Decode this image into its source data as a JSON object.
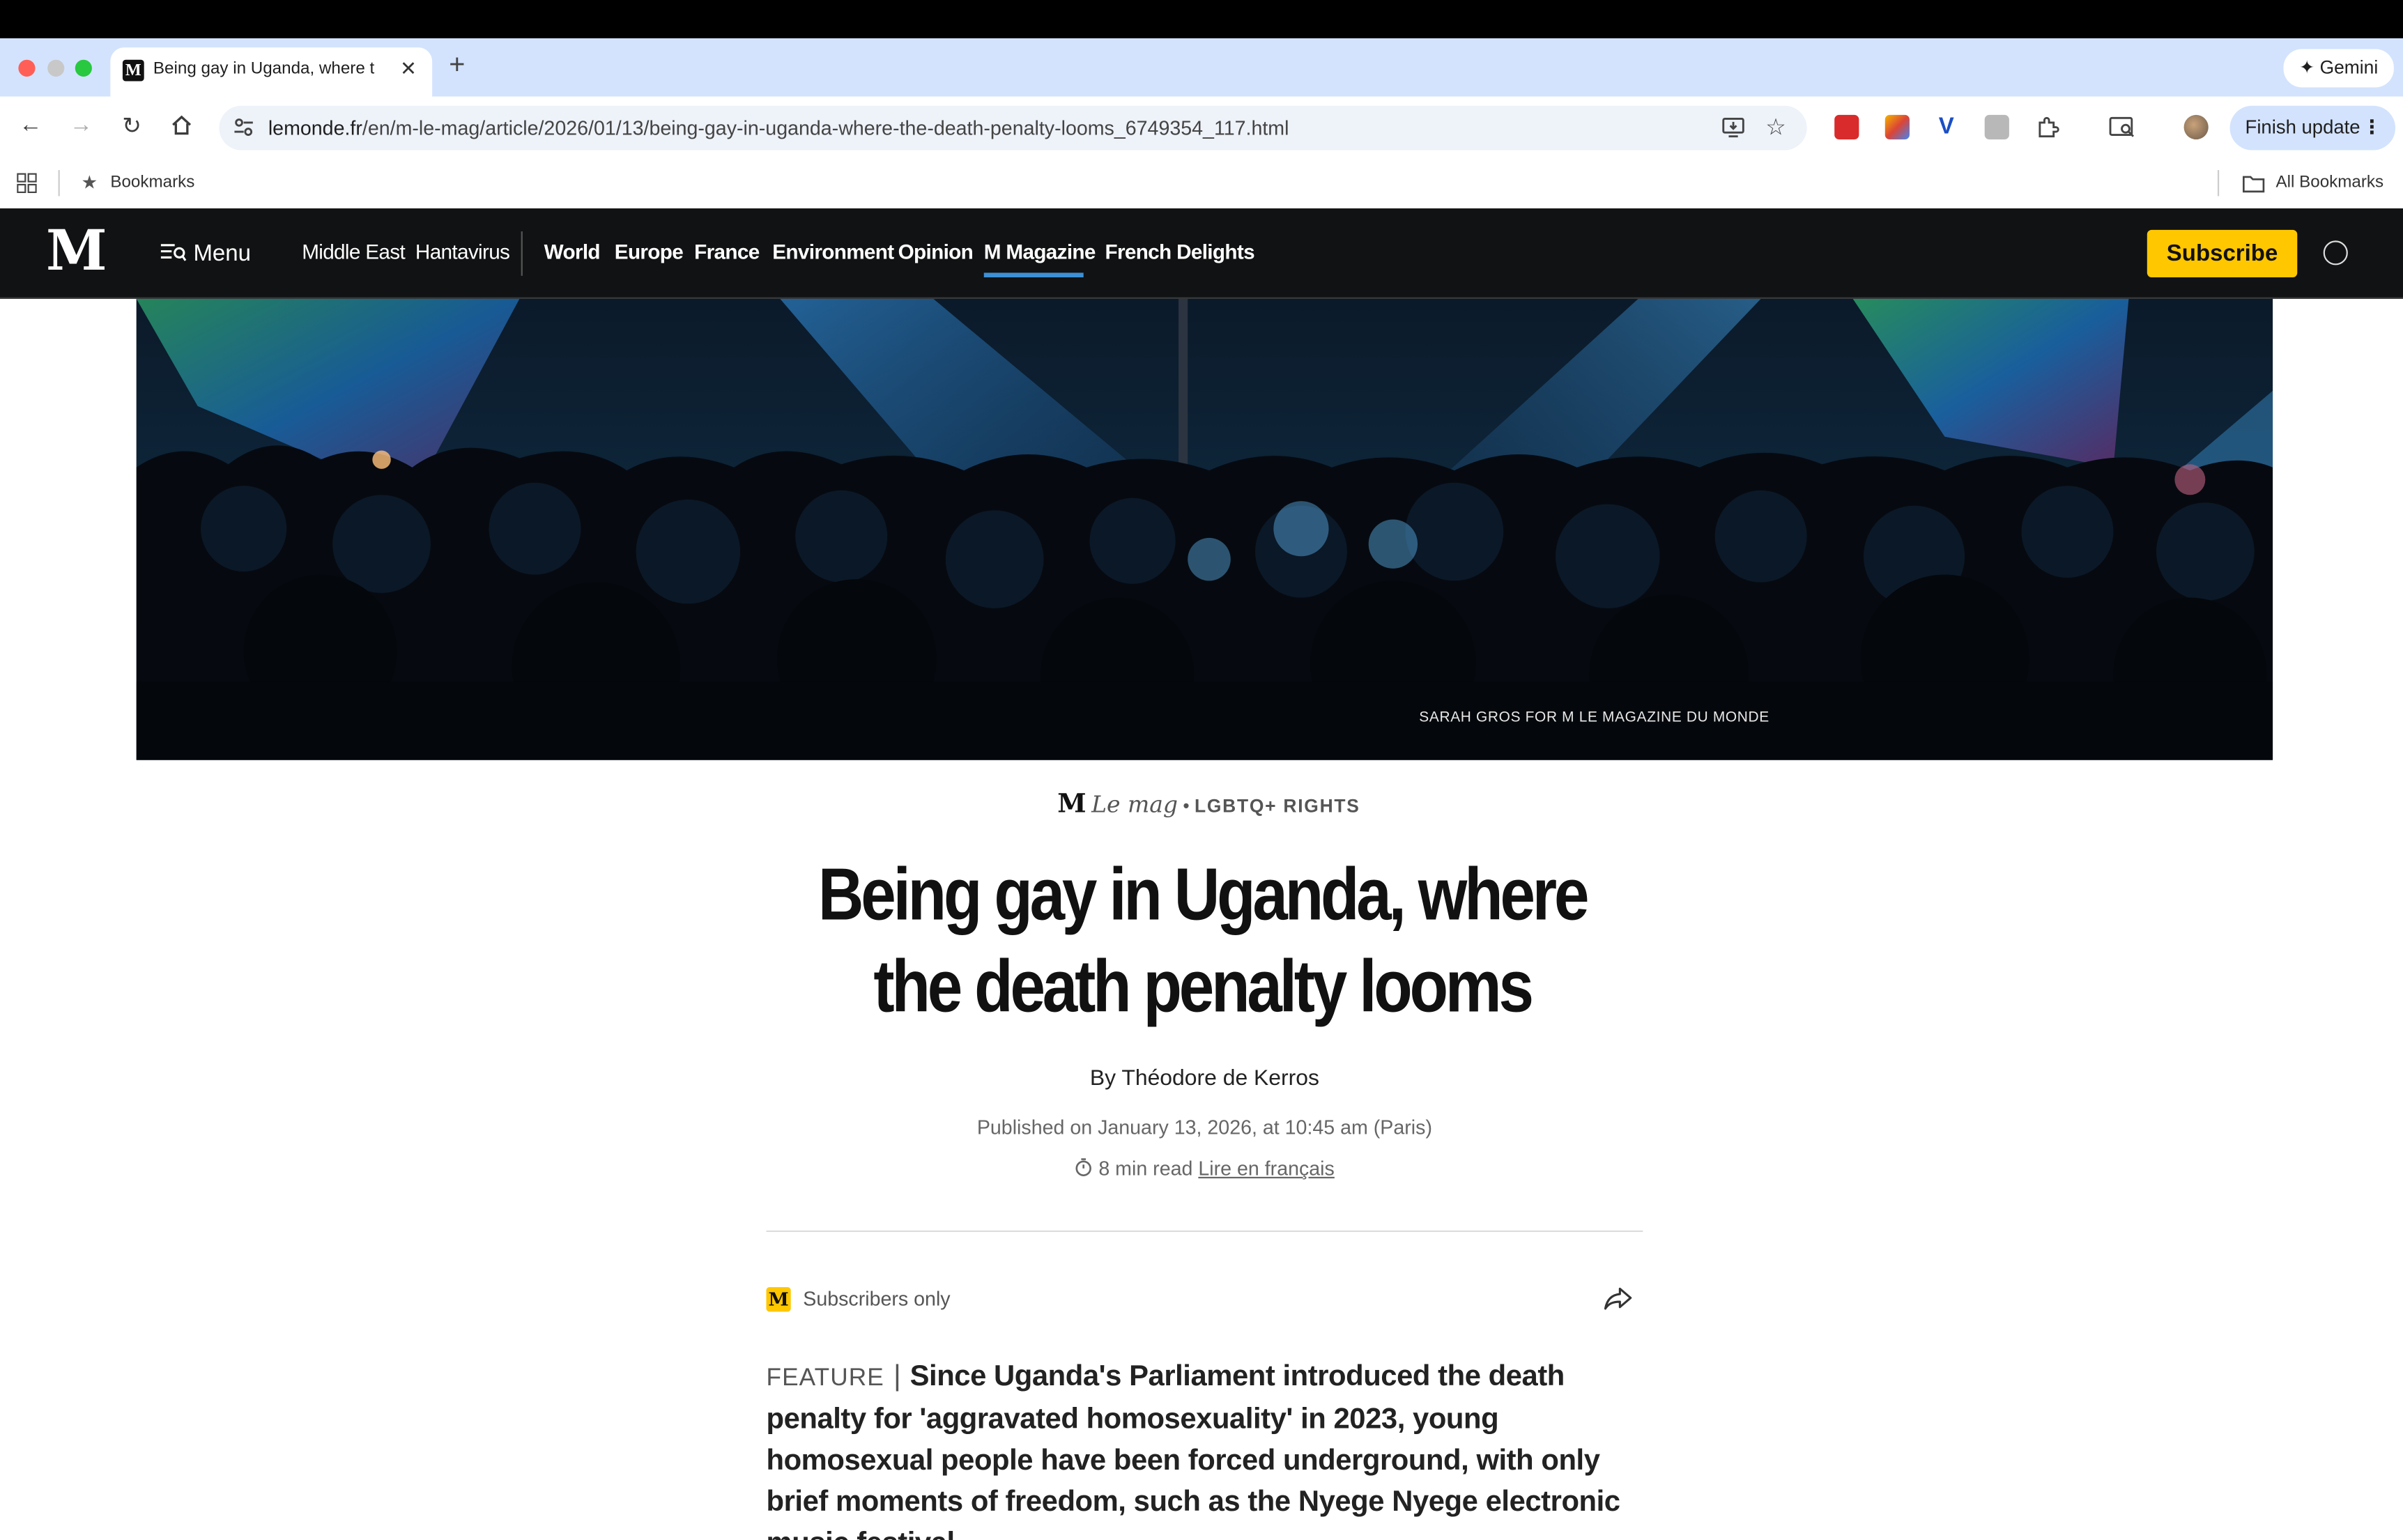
{
  "browser": {
    "tab_title": "Being gay in Uganda, where t",
    "tab_favicon": "M",
    "new_tab_label": "+",
    "gemini_label": "Gemini",
    "url_host": "lemonde.fr",
    "url_path": "/en/m-le-mag/article/2026/01/13/being-gay-in-uganda-where-the-death-penalty-looms_6749354_117.html",
    "finish_update_label": "Finish update",
    "bookmarks_label": "Bookmarks",
    "all_bookmarks_label": "All Bookmarks"
  },
  "site_nav": {
    "logo": "M",
    "menu_label": "Menu",
    "links": [
      "Middle East",
      "Hantavirus",
      "World",
      "Europe",
      "France",
      "Environment",
      "Opinion",
      "M Magazine",
      "French Delights"
    ],
    "active_link": "M Magazine",
    "subscribe_label": "Subscribe",
    "accent_color": "#ffc700",
    "active_underline_color": "#3c90d6"
  },
  "hero": {
    "caption": "SARAH GROS FOR M LE MAGAZINE DU MONDE"
  },
  "article": {
    "kicker_logo": "M",
    "kicker_mag": "Le mag",
    "kicker_separator": "•",
    "rubric": "LGBTQ+ RIGHTS",
    "title": "Being gay in Uganda, where the death penalty looms",
    "byline": "By Théodore de Kerros",
    "published": "Published on January 13, 2026, at 10:45 am (Paris)",
    "read_time": "8 min read",
    "french_link": "Lire en français",
    "subscribers_label": "Subscribers only",
    "lead_label": "FEATURE",
    "lead_separator": "|",
    "lead_text": "Since Uganda's Parliament introduced the death penalty for 'aggravated homosexuality' in 2023, young homosexual people have been forced underground, with only brief moments of freedom, such as the Nyege Nyege electronic music festival."
  }
}
